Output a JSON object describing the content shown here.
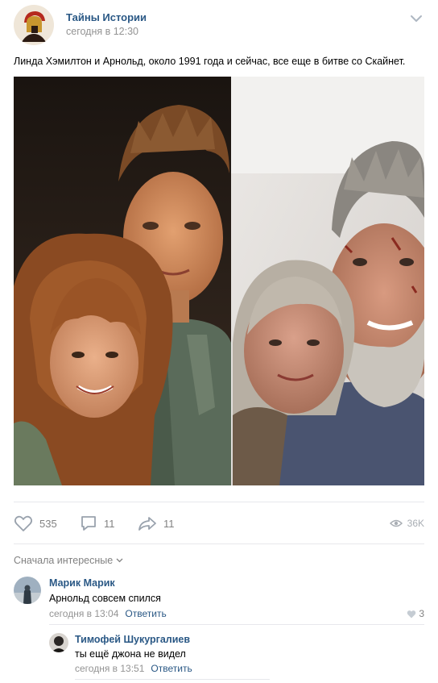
{
  "post": {
    "group_name": "Тайны Истории",
    "time": "сегодня в 12:30",
    "text": "Линда Хэмилтон и Арнольд, около 1991 года и сейчас, все еще в битве со Скайнет."
  },
  "actions": {
    "likes": "535",
    "comments": "11",
    "shares": "11",
    "views": "36K"
  },
  "comments_section": {
    "sort_label": "Сначала интересные",
    "reply_label": "Ответить",
    "comments": [
      {
        "author": "Марик Марик",
        "text": "Арнольд совсем спился",
        "time": "сегодня в 13:04",
        "likes": "3"
      },
      {
        "author": "Тимофей Шукургалиев",
        "text": "ты ещё джона не видел",
        "time": "сегодня в 13:51"
      }
    ]
  },
  "colors": {
    "link": "#2a5885",
    "muted": "#828282",
    "separator": "#e7e8ec"
  },
  "icons": [
    "chevron-down-icon",
    "heart-icon",
    "comment-icon",
    "share-icon",
    "eye-icon"
  ]
}
